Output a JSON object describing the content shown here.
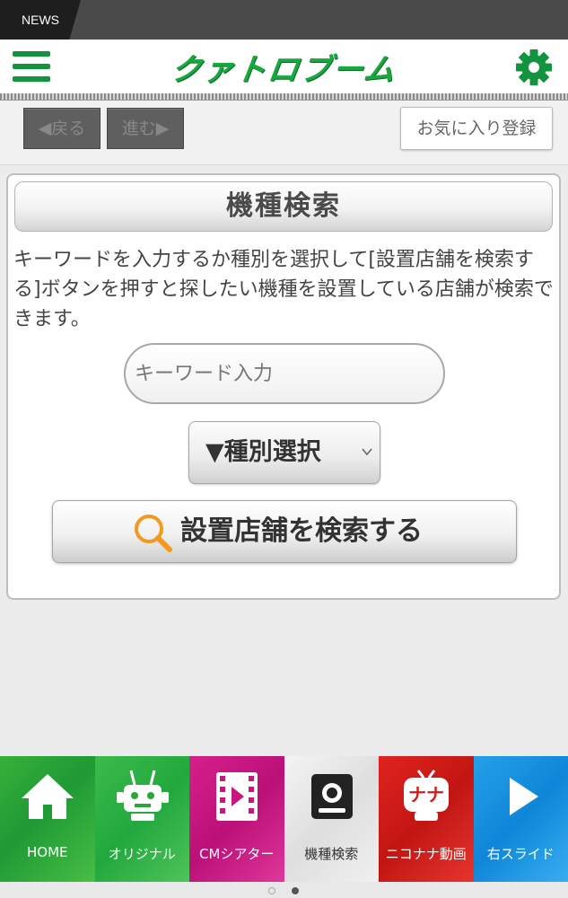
{
  "news_bar": {
    "tab_label": "NEWS"
  },
  "header": {
    "logo_text": "クァトロブーム"
  },
  "nav": {
    "back_label": "◀戻る",
    "forward_label": "進む▶",
    "favorite_label": "お気に入り登録"
  },
  "search_panel": {
    "title": "機種検索",
    "description": "キーワードを入力するか種別を選択して[設置店舗を検索する]ボタンを押すと探したい機種を設置している店舗が検索できます。",
    "keyword_placeholder": "キーワード入力",
    "type_select_label": "▼種別選択",
    "search_button_label": "設置店舗を検索する"
  },
  "bottom_tabs": [
    {
      "label": "HOME",
      "icon": "home-icon",
      "color": "#2aa63a"
    },
    {
      "label": "オリジナル",
      "icon": "robot-icon",
      "color": "#2db045"
    },
    {
      "label": "CMシアター",
      "icon": "film-play-icon",
      "color": "#c8167f"
    },
    {
      "label": "機種検索",
      "icon": "slot-machine-icon",
      "color": "#e6e6e6"
    },
    {
      "label": "ニコナナ動画",
      "icon": "tv-mascot-icon",
      "color": "#d11d1a"
    },
    {
      "label": "右スライド",
      "icon": "play-arrow-icon",
      "color": "#1c94e0"
    }
  ],
  "pager": {
    "page_count": 2,
    "current_page": 2
  }
}
